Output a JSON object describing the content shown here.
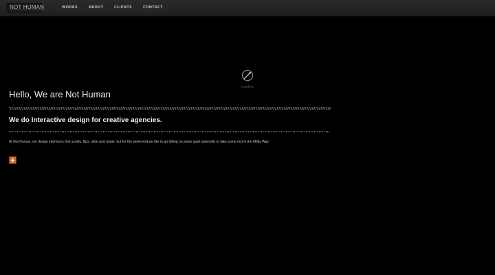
{
  "header": {
    "logo_text": "NOT HUMAN",
    "nav": {
      "works": "WORKS",
      "about": "ABOUT",
      "clients": "CLIENTS",
      "contact": "CONTACT"
    }
  },
  "loader": {
    "icon": "spinner-icon",
    "label": "Loading"
  },
  "hero": {
    "title": "Hello, We are Not Human",
    "subtitle": "We do Interactive design for creative agencies.",
    "body": "At Not Human, we design interfaces that scrolls, flips, slide and rotate, but for the week-end we like to go hiking on some quiet asteroids or take some rest in the Milky Way.",
    "more_button_icon": "plus-icon"
  },
  "colors": {
    "background": "#000000",
    "topbar": "#242424",
    "accent": "#d2692a",
    "text": "#f2f2f2"
  }
}
